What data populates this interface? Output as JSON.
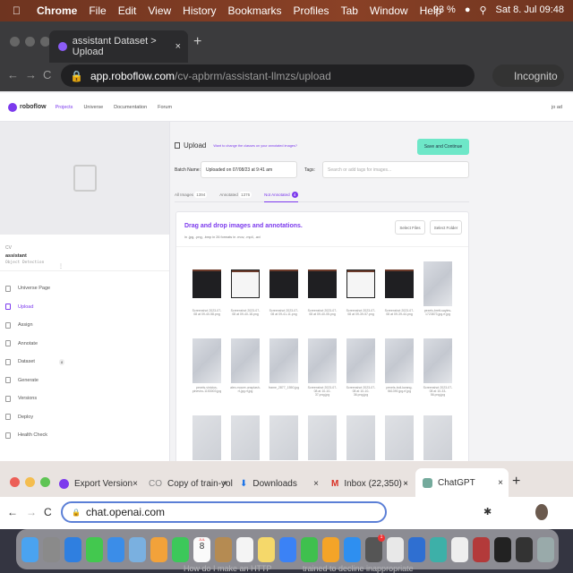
{
  "menubar": {
    "apple": "",
    "app": "Chrome",
    "items": [
      "File",
      "Edit",
      "View",
      "History",
      "Bookmarks",
      "Profiles",
      "Tab",
      "Window",
      "Help"
    ],
    "battery": "93 %",
    "datetime": "Sat 8. Jul  09:48"
  },
  "window1": {
    "tab_title": "assistant Dataset > Upload",
    "url_host": "app.roboflow.com",
    "url_path": "/cv-apbrm/assistant-llmzs/upload",
    "profile": "Incognito"
  },
  "roboflow": {
    "logo": "roboflow",
    "nav": [
      "Projects",
      "Universe",
      "Documentation",
      "Forum"
    ],
    "user": "jo ad"
  },
  "sidebar": {
    "workspace": "CV",
    "project": "assistant",
    "project_type": "Object Detection",
    "items": [
      {
        "label": "Universe Page"
      },
      {
        "label": "Upload",
        "active": true
      },
      {
        "label": "Assign"
      },
      {
        "label": "Annotate"
      },
      {
        "label": "Dataset",
        "badge": "8"
      },
      {
        "label": "Generate"
      },
      {
        "label": "Versions"
      },
      {
        "label": "Deploy"
      },
      {
        "label": "Health Check"
      }
    ]
  },
  "upload": {
    "title": "Upload",
    "hint": "Want to change the classes on your annotated images?",
    "save_button": "Save and Continue",
    "batch_label": "Batch Name:",
    "batch_value": "Uploaded on 07/08/23 at 9:41 am",
    "tags_label": "Tags:",
    "tags_placeholder": "Search or add tags for images...",
    "tabs": [
      {
        "label": "All Images",
        "count": "1394"
      },
      {
        "label": "Annotated",
        "count": "1376"
      },
      {
        "label": "Not Annotated",
        "count": "4",
        "active": true
      }
    ],
    "dropzone_title": "Drag and drop images and annotations.",
    "formats": "in .jpg, .png, .bmp  in 26 formats  in .mov, .mp4, .avi",
    "select_files": "Select Files",
    "select_folder": "Select Folder",
    "thumbnails": [
      {
        "caption": "Screenshot 2023-07-08 at 09-40-58.png",
        "kind": "dark"
      },
      {
        "caption": "Screenshot 2023-07-08 at 09-40-18.png",
        "kind": "light"
      },
      {
        "caption": "Screenshot 2023-07-08 at 09-41-11.png",
        "kind": "dark"
      },
      {
        "caption": "Screenshot 2023-07-08 at 09-40-05.png",
        "kind": "dark"
      },
      {
        "caption": "Screenshot 2023-07-08 at 09-39-57.png",
        "kind": "light"
      },
      {
        "caption": "Screenshot 2023-07-08 at 09-39-44.png",
        "kind": "dark"
      },
      {
        "caption": "pexels-brett-sayles-1723873.jpg.rf.jpg",
        "kind": "photo"
      },
      {
        "caption": "pexels-vinicius-pineviro-1153003.jpg",
        "kind": "photo"
      },
      {
        "caption": "alex-moore-unsplash-rf-jpg.rf.jpg",
        "kind": "photo"
      },
      {
        "caption": "frame_2877_1550.jpg",
        "kind": "photo"
      },
      {
        "caption": "Screenshot 2023-07-08 at 10-10-37.png.jpg",
        "kind": "photo"
      },
      {
        "caption": "Screenshot 2023-07-08 at 10-10-36.png.jpg",
        "kind": "photo"
      },
      {
        "caption": "pexels-boil-kwang-561390.jpg.rf.jpg",
        "kind": "photo"
      },
      {
        "caption": "Screenshot 2023-07-08 at 10-33-56.png.jpg",
        "kind": "photo"
      }
    ]
  },
  "window2": {
    "tabs": [
      "Export Version",
      "Copy of train-yol",
      "Downloads",
      "Inbox (22,350) -",
      "ChatGPT"
    ],
    "url": "chat.openai.com",
    "content_lines": [
      "How do I make an HTTP",
      "trained to decline inappropriate"
    ]
  },
  "dock": {
    "calendar_month": "JUL",
    "calendar_day": "8",
    "badge": "1"
  }
}
